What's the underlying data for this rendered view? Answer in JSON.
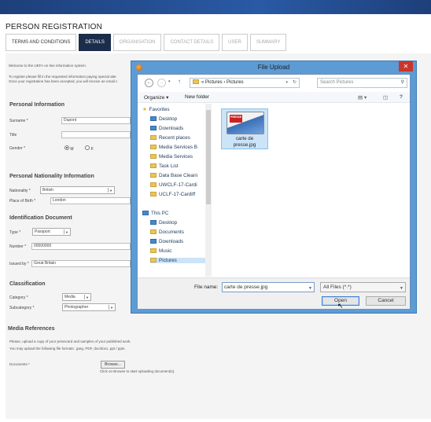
{
  "page": {
    "title": "PERSON REGISTRATION",
    "tabs": [
      "TERMS AND CONDITIONS",
      "DETAILS",
      "ORGANISATION",
      "CONTACT DETAILS",
      "USER",
      "SUMMARY"
    ],
    "active_tab": "DETAILS"
  },
  "intro": {
    "line1": "Welcome to the UEFA on-line information system.",
    "line2": "To register please fill in the requested information paying special atte",
    "line3": "Once your registration has been accepted, you will receive an email c"
  },
  "personal": {
    "heading": "Personal Information",
    "surname_label": "Surname *",
    "surname_value": "Dupont",
    "title_label": "Title",
    "gender_label": "Gender *",
    "gender_m": "M",
    "gender_f": "F"
  },
  "nationality": {
    "heading": "Personal Nationality Information",
    "nationality_label": "Nationality *",
    "nationality_value": "British",
    "pob_label": "Place of Birth *",
    "pob_value": "London"
  },
  "identification": {
    "heading": "Identification Document",
    "type_label": "Type *",
    "type_value": "Passport",
    "number_label": "Number *",
    "number_value": "00000000",
    "issued_label": "Issued by *",
    "issued_value": "Great Britain"
  },
  "classification": {
    "heading": "Classification",
    "category_label": "Category *",
    "category_value": "Media",
    "subcategory_label": "Subcategory *",
    "subcategory_value": "Photographer"
  },
  "media": {
    "heading": "Media References",
    "line1": "Please, upload a copy of your presscard and samples of your published work.",
    "line2": "You may upload the following file formats: .jpeg, PDF, doc/docx, ppt / pptx.",
    "documents_label": "Documents *",
    "browse_label": "Browse...",
    "hint": "Click on Browse to start uploading document(s)."
  },
  "dialog": {
    "title": "File Upload",
    "close": "✕",
    "path": "«  Pictures  ›  Pictures",
    "search_placeholder": "Search Pictures",
    "organize": "Organize ▾",
    "new_folder": "New folder",
    "nav_items": [
      {
        "label": "Favorites",
        "icon": "star"
      },
      {
        "label": "Desktop",
        "icon": "blue"
      },
      {
        "label": "Downloads",
        "icon": "blue"
      },
      {
        "label": "Recent places",
        "icon": "folder"
      },
      {
        "label": "Media Services B",
        "icon": "folder"
      },
      {
        "label": "Media Services",
        "icon": "folder"
      },
      {
        "label": "Task List",
        "icon": "folder"
      },
      {
        "label": "Data Base Cleani",
        "icon": "folder"
      },
      {
        "label": "UWCLF-17-Cardi",
        "icon": "folder"
      },
      {
        "label": "UCLF-17-Cardiff",
        "icon": "folder"
      },
      {
        "label": "This PC",
        "icon": "blue"
      },
      {
        "label": "Desktop",
        "icon": "blue"
      },
      {
        "label": "Documents",
        "icon": "folder"
      },
      {
        "label": "Downloads",
        "icon": "blue"
      },
      {
        "label": "Music",
        "icon": "folder"
      },
      {
        "label": "Pictures",
        "icon": "folder"
      }
    ],
    "file_name_line1": "carte de",
    "file_name_line2": "presse.jpg",
    "thumb_text": "PRESSE",
    "file_name_label": "File name:",
    "file_name_value": "carte de presse.jpg",
    "filter_value": "All Files (*.*)",
    "open_label": "Open",
    "cancel_label": "Cancel"
  }
}
